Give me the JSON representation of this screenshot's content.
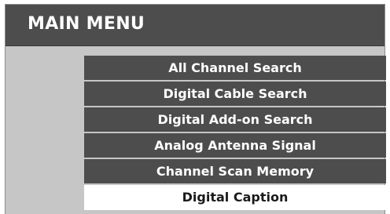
{
  "title": "MAIN MENU",
  "menu": {
    "items": [
      {
        "label": "All Channel Search"
      },
      {
        "label": "Digital Cable Search"
      },
      {
        "label": "Digital Add-on Search"
      },
      {
        "label": "Analog Antenna Signal"
      },
      {
        "label": "Channel Scan Memory"
      },
      {
        "label": "Digital Caption"
      }
    ],
    "selected_label": "Digital Caption"
  },
  "colors": {
    "title_bar": "#4d4d4d",
    "panel": "#c6c6c6",
    "item_bg": "#4d4d4d",
    "item_text": "#ffffff",
    "selected_bg": "#ffffff",
    "selected_text": "#1a1a1a"
  }
}
